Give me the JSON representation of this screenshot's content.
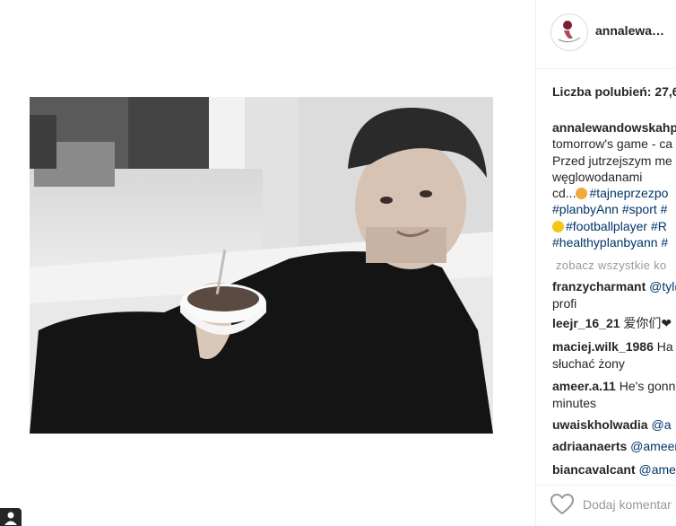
{
  "post": {
    "username": "annalewa…",
    "likes_label": "Liczba polubień: 27,6",
    "caption_lines": [
      {
        "user": "annalewandowskahp",
        "text": ""
      },
      {
        "text": "tomorrow's game - ca"
      },
      {
        "text": "Przed jutrzejszym me"
      },
      {
        "text": "węglowodanami"
      },
      {
        "text": "cd...",
        "emoji_color": "#f2a93b",
        "tag": "#tajneprzezpo"
      },
      {
        "tag": "#planbyAnn #sport #"
      },
      {
        "emoji_color": "#f5c518",
        "tag": "#footballplayer #R"
      },
      {
        "tag": "#healthyplanbyann #"
      }
    ],
    "view_all": "zobacz wszystkie ko",
    "comments": [
      {
        "user": "franzycharmant",
        "text": "",
        "mention": "@tyl(",
        "line2": "profi"
      },
      {
        "user": "leejr_16_21",
        "text": "爱你们❤"
      },
      {
        "user": "maciej.wilk_1986",
        "text": "Ha",
        "line2": "słuchać żony"
      },
      {
        "user": "ameer.a.11",
        "text": "He's gonn",
        "line2": "minutes"
      },
      {
        "user": "uwaiskholwadia",
        "text": "",
        "mention": "@a"
      },
      {
        "user": "adriaanaerts",
        "text": "",
        "mention": "@ameer"
      },
      {
        "user": "biancavalcant",
        "text": "",
        "mention": "@ame"
      }
    ],
    "add_comment_placeholder": "Dodaj komentar"
  },
  "icons": {
    "like": "heart-icon",
    "corner": "user-icon"
  },
  "colors": {
    "tag": "#003569",
    "muted": "#999999",
    "text": "#262626"
  }
}
